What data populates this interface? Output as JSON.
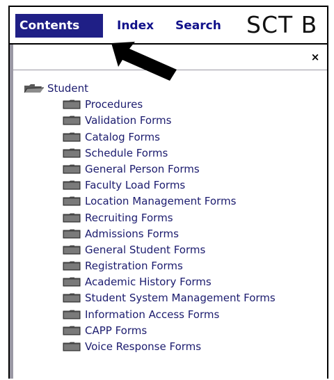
{
  "tabs": {
    "contents": "Contents",
    "index": "Index",
    "search": "Search"
  },
  "app_title": "SCT B",
  "close_label": "×",
  "tree": {
    "root": "Student",
    "children": [
      "Procedures",
      "Validation Forms",
      "Catalog Forms",
      "Schedule Forms",
      "General Person Forms",
      "Faculty Load Forms",
      "Location Management Forms",
      "Recruiting Forms",
      "Admissions Forms",
      "General Student Forms",
      "Registration Forms",
      "Academic History Forms",
      "Student System Management Forms",
      "Information Access Forms",
      "CAPP Forms",
      "Voice Response Forms"
    ]
  },
  "colors": {
    "active_tab_bg": "#1f1f86",
    "tab_text": "#11118a",
    "tree_text": "#1b1b6e",
    "stripe": "#9a98a4"
  },
  "icons": {
    "root": "open-folder-icon",
    "child": "closed-folder-icon",
    "pointer": "arrow-pointer-icon"
  }
}
